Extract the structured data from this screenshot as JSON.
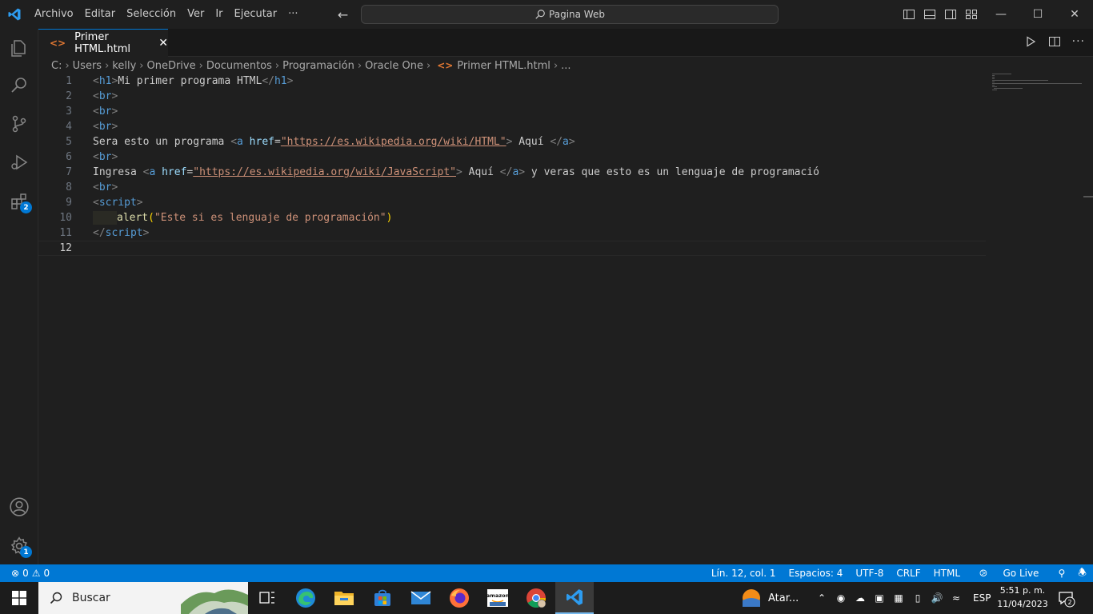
{
  "titlebar": {
    "menus": [
      "Archivo",
      "Editar",
      "Selección",
      "Ver",
      "Ir",
      "Ejecutar",
      "···"
    ],
    "command_center": "Pagina Web",
    "window_controls": [
      "minimize",
      "maximize",
      "close"
    ]
  },
  "activitybar": {
    "items": [
      {
        "name": "explorer-icon"
      },
      {
        "name": "search-icon"
      },
      {
        "name": "source-control-icon"
      },
      {
        "name": "run-debug-icon"
      },
      {
        "name": "extensions-icon",
        "badge": "2"
      }
    ],
    "bottom": [
      {
        "name": "accounts-icon"
      },
      {
        "name": "manage-gear-icon",
        "badge": "1"
      }
    ]
  },
  "tab": {
    "label": "Primer HTML.html",
    "close": "✕"
  },
  "breadcrumb": [
    "C:",
    "Users",
    "kelly",
    "OneDrive",
    "Documentos",
    "Programación",
    "Oracle One",
    "Primer HTML.html",
    "..."
  ],
  "editor": {
    "line_numbers": [
      "1",
      "2",
      "3",
      "4",
      "5",
      "6",
      "7",
      "8",
      "9",
      "10",
      "11",
      "12"
    ],
    "current_line": 12,
    "lines": {
      "l1": {
        "open": "<",
        "tag": "h1",
        "close": ">",
        "text": "Mi primer programa HTML",
        "end_open": "</",
        "end_close": ">"
      },
      "l5": {
        "pre": "Sera esto un programa ",
        "attr": "href",
        "eq": "=",
        "url": "\"https://es.wikipedia.org/wiki/HTML\"",
        "text": " Aquí ",
        "post": ""
      },
      "l7": {
        "pre": "Ingresa ",
        "attr": "href",
        "eq": "=",
        "url": "\"https://es.wikipedia.org/wiki/JavaScript\"",
        "text": " Aquí ",
        "post": " y veras que esto es un lenguaje de programació"
      },
      "l10": {
        "fn": "alert",
        "arg": "\"Este si es lenguaje de programación\""
      }
    }
  },
  "statusbar": {
    "errors": "0",
    "warnings": "0",
    "position": "Lín. 12, col. 1",
    "spaces": "Espacios: 4",
    "encoding": "UTF-8",
    "eol": "CRLF",
    "language": "HTML",
    "golive": "Go Live"
  },
  "taskbar": {
    "search_placeholder": "Buscar",
    "weather": "Atar...",
    "language": "ESP",
    "time": "5:51 p. m.",
    "date": "11/04/2023",
    "notifications": "2",
    "amazon_label": "amazon"
  },
  "colors": {
    "accent": "#0078d4",
    "html_tag": "#569cd6",
    "string": "#ce9178",
    "attribute": "#9cdcfe"
  }
}
